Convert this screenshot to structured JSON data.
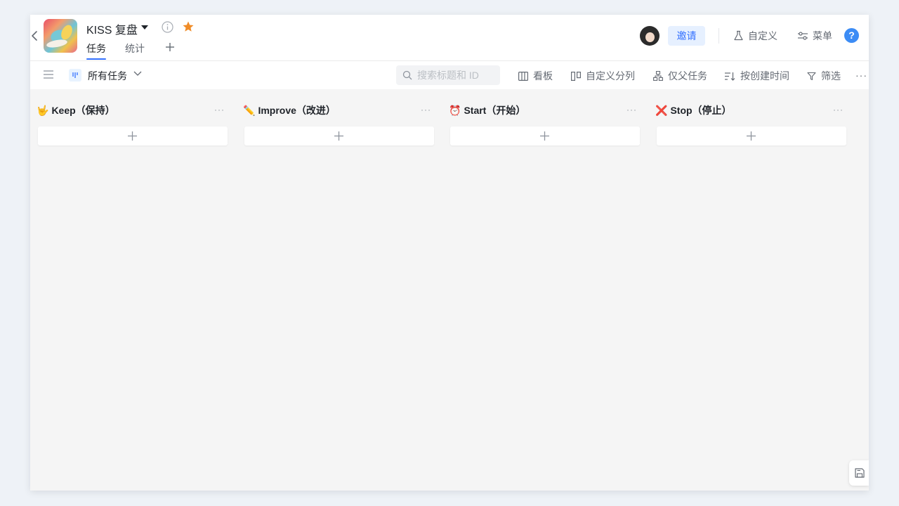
{
  "project": {
    "title": "KISS 复盘",
    "tabs": [
      {
        "label": "任务",
        "active": true
      },
      {
        "label": "统计",
        "active": false
      }
    ]
  },
  "header": {
    "invite_label": "邀请",
    "customize_label": "自定义",
    "menu_label": "菜单",
    "help_label": "?"
  },
  "toolbar": {
    "view_label": "所有任务",
    "search_placeholder": "搜索标题和 ID",
    "board_label": "看板",
    "custom_group_label": "自定义分列",
    "parent_only_label": "仅父任务",
    "sort_label": "按创建时间",
    "filter_label": "筛选"
  },
  "columns": [
    {
      "emoji": "🤟",
      "title": "Keep（保持）"
    },
    {
      "emoji": "✏️",
      "title": "Improve（改进）"
    },
    {
      "emoji": "⏰",
      "title": "Start（开始）"
    },
    {
      "emoji": "❌",
      "title": "Stop（停止）"
    }
  ],
  "colors": {
    "accent": "#3370ff",
    "star": "#f08c28",
    "help": "#3c8cf5",
    "stop_red": "#e0301e"
  }
}
